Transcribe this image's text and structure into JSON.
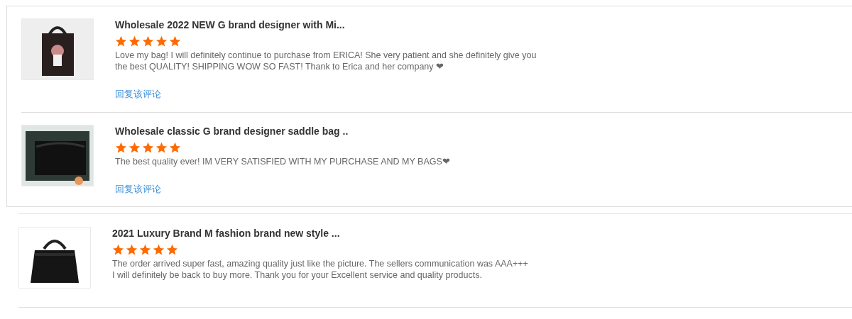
{
  "groups": [
    {
      "boxed": true,
      "reviews": [
        {
          "title": "Wholesale 2022 NEW G brand designer with Mi...",
          "stars": 5,
          "lines": [
            "Love my bag! I will definitely continue to purchase from ERICA! She very patient and she definitely give you",
            "the best QUALITY! SHIPPING WOW SO FAST! Thank to Erica and her company ❤"
          ],
          "reply": "回复该评论",
          "kind": "tote"
        },
        {
          "title": "Wholesale classic G brand designer saddle bag ..",
          "stars": 5,
          "lines": [
            "The best quality ever! IM VERY SATISFIED WITH MY PURCHASE AND MY BAGS❤"
          ],
          "reply": "回复该评论",
          "kind": "box"
        }
      ]
    },
    {
      "boxed": false,
      "reviews": [
        {
          "title": "2021 Luxury Brand M fashion brand new style ...",
          "stars": 5,
          "lines": [
            "The order arrived super fast, amazing quality just like the picture.  The sellers communication was AAA+++",
            "I will definitely be back to buy more.  Thank you for your Excellent service and quality products."
          ],
          "kind": "plain"
        }
      ]
    }
  ]
}
